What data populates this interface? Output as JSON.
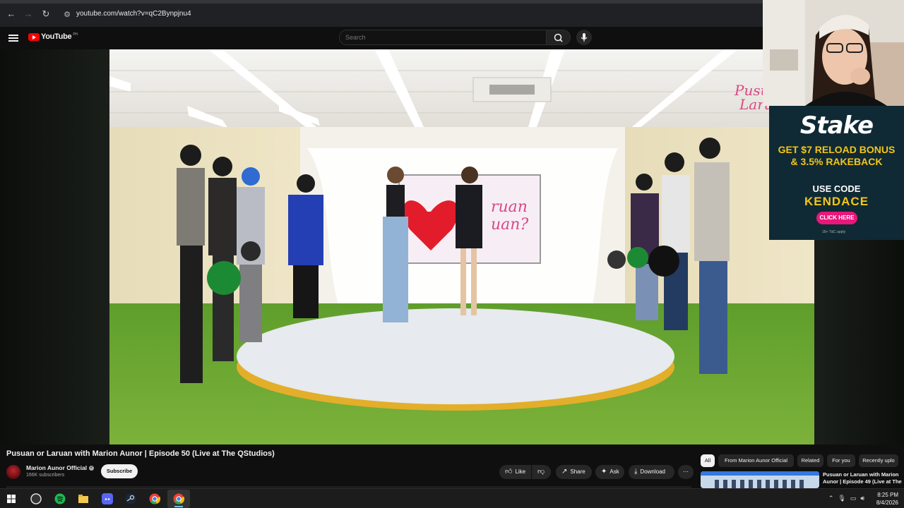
{
  "browser": {
    "url": "youtube.com/watch?v=qC2Bynpjnu4",
    "back_icon": "←",
    "forward_icon": "→",
    "reload_icon": "↻",
    "site_info_icon": "⚙"
  },
  "youtube": {
    "logo_text": "YouTube",
    "region": "PH",
    "search_placeholder": "Search"
  },
  "video": {
    "title": "Pusuan or Laruan with Marion Aunor | Episode 50 (Live at The QStudios)",
    "channel_name": "Marion Aunor Official",
    "subscribers": "166K subscribers",
    "subscribe_label": "Subscribe",
    "actions": {
      "like": "Like",
      "share": "Share",
      "ask": "Ask",
      "download": "Download",
      "more": "⋯"
    }
  },
  "ad": {
    "brand": "Stake",
    "offer": "GET $7 RELOAD BONUS & 3.5% RAKEBACK",
    "use_code": "USE CODE",
    "code": "KENDACE",
    "cta": "CLICK HERE",
    "fine_print": "18+ T&C apply"
  },
  "chips": [
    "All",
    "From Marion Aunor Official",
    "Related",
    "For you",
    "Recently uplo"
  ],
  "related": {
    "title": "Pusuan or Laruan with Marion Aunor | Episode 49 (Live at The ..."
  },
  "taskbar": {
    "time": "8:25 PM",
    "date": "8/4/2026"
  },
  "colors": {
    "yt_red": "#ff0000",
    "stake_gold": "#f5c518",
    "stake_pink": "#e9177b",
    "grass": "#5f9e2c"
  }
}
